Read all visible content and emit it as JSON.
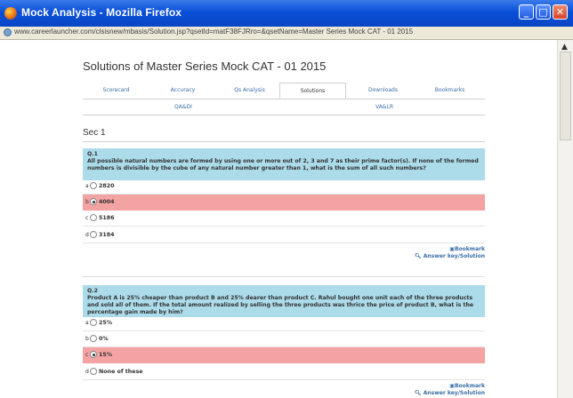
{
  "window": {
    "title": "Mock Analysis - Mozilla Firefox",
    "url": "www.careerlauncher.com/clsisnew/mbasis/Solution.jsp?qsetId=matF38FJRro=&qsetName=Master Series Mock CAT - 01 2015",
    "buttons": {
      "minimize": "_",
      "maximize": "□",
      "close": "✕"
    }
  },
  "page": {
    "heading": "Solutions of Master Series Mock CAT - 01 2015",
    "tabs": [
      "Scorecard",
      "Accuracy",
      "Qs Analysis",
      "Solutions",
      "Downloads",
      "Bookmarks"
    ],
    "active_tab": "Solutions",
    "subtabs": [
      "QA&DI",
      "VA&LR"
    ],
    "section": "Sec 1"
  },
  "questions": [
    {
      "number": "Q.1",
      "text": "All possible natural numbers are formed by using one or more out of 2, 3 and 7 as their prime factor(s). If none of the formed numbers is divisible by the cube of any natural number greater than 1, what is the sum of all such numbers?",
      "options": [
        {
          "letter": "a",
          "text": "2820"
        },
        {
          "letter": "b",
          "text": "4004"
        },
        {
          "letter": "c",
          "text": "5186"
        },
        {
          "letter": "d",
          "text": "3184"
        }
      ],
      "selected": "b",
      "bookmark_label": "Bookmark",
      "answer_label": "Answer key/Solution"
    },
    {
      "number": "Q.2",
      "text": "Product A is 25% cheaper than product B and 25% dearer than product C. Rahul bought one unit each of the three products and sold all of them. If the total amount realized by selling the three products was thrice the price of product B, what is the percentage gain made by him?",
      "options": [
        {
          "letter": "a",
          "text": "25%"
        },
        {
          "letter": "b",
          "text": "0%"
        },
        {
          "letter": "c",
          "text": "15%"
        },
        {
          "letter": "d",
          "text": "None of these"
        }
      ],
      "selected": "c",
      "bookmark_label": "Bookmark",
      "answer_label": "Answer key/Solution"
    }
  ]
}
